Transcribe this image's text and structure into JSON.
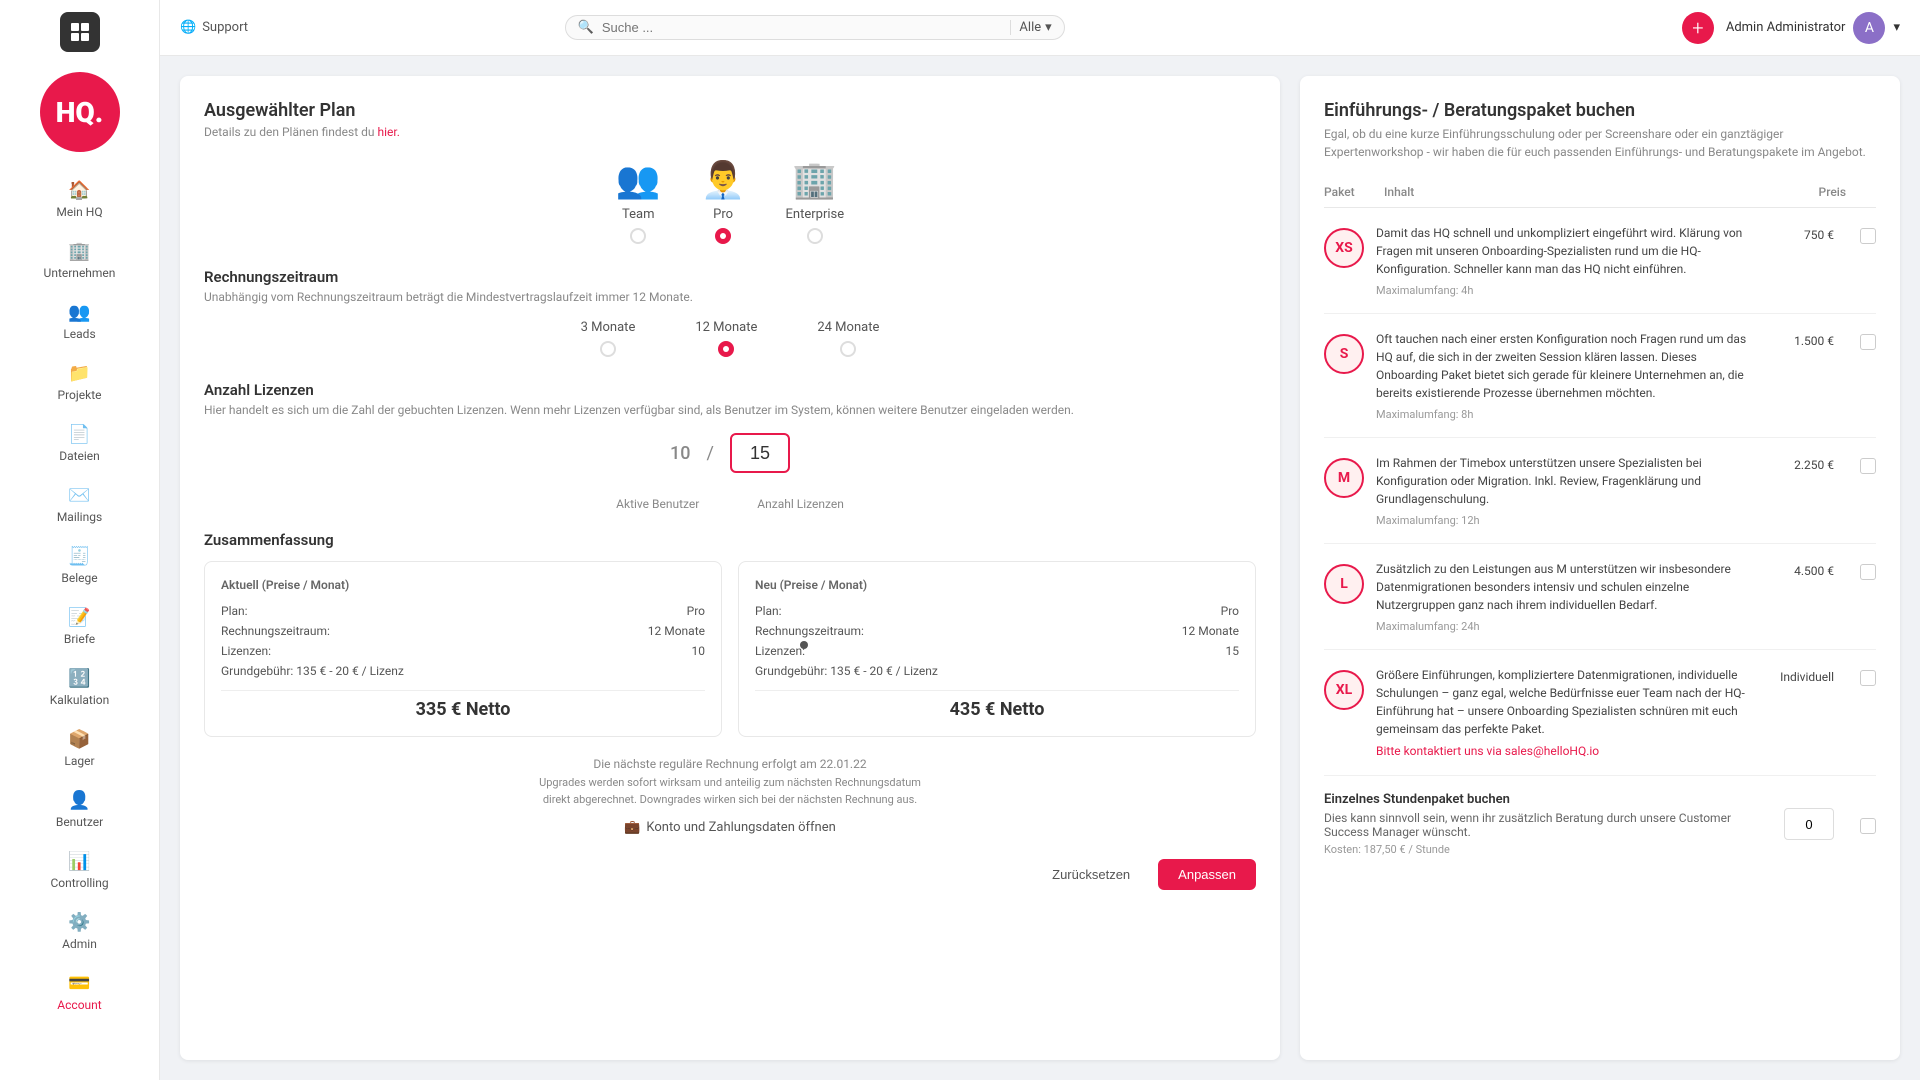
{
  "app": {
    "logo_text": "HQ.",
    "logo_small_text": "HQ"
  },
  "topbar": {
    "support_label": "Support",
    "search_placeholder": "Suche ...",
    "filter_label": "Alle",
    "user_name": "Admin Administrator",
    "add_icon": "+"
  },
  "sidebar": {
    "items": [
      {
        "id": "mein-hq",
        "label": "Mein HQ",
        "icon": "🏠"
      },
      {
        "id": "unternehmen",
        "label": "Unternehmen",
        "icon": "🏢"
      },
      {
        "id": "leads",
        "label": "Leads",
        "icon": "👥"
      },
      {
        "id": "projekte",
        "label": "Projekte",
        "icon": "📁"
      },
      {
        "id": "dateien",
        "label": "Dateien",
        "icon": "📄"
      },
      {
        "id": "mailings",
        "label": "Mailings",
        "icon": "✉️"
      },
      {
        "id": "belege",
        "label": "Belege",
        "icon": "🧾"
      },
      {
        "id": "briefe",
        "label": "Briefe",
        "icon": "📝"
      },
      {
        "id": "kalkulation",
        "label": "Kalkulation",
        "icon": "🔢"
      },
      {
        "id": "lager",
        "label": "Lager",
        "icon": "📦"
      },
      {
        "id": "benutzer",
        "label": "Benutzer",
        "icon": "👤"
      },
      {
        "id": "controlling",
        "label": "Controlling",
        "icon": "📊"
      },
      {
        "id": "admin",
        "label": "Admin",
        "icon": "⚙️"
      },
      {
        "id": "account",
        "label": "Account",
        "icon": "💳"
      }
    ]
  },
  "left_panel": {
    "title": "Ausgewählter Plan",
    "subtitle_text": "Details zu den Plänen findest du ",
    "subtitle_link": "hier.",
    "plans": [
      {
        "id": "team",
        "label": "Team",
        "selected": false,
        "icon": "👥"
      },
      {
        "id": "pro",
        "label": "Pro",
        "selected": true,
        "icon": "👨‍💼"
      },
      {
        "id": "enterprise",
        "label": "Enterprise",
        "selected": false,
        "icon": "🏢"
      }
    ],
    "billing_section_title": "Rechnungszeitraum",
    "billing_section_note": "Unabhängig vom Rechnungszeitraum beträgt die Mindestvertragslaufzeit immer 12 Monate.",
    "billing_options": [
      {
        "id": "3m",
        "label": "3 Monate",
        "selected": false
      },
      {
        "id": "12m",
        "label": "12 Monate",
        "selected": true
      },
      {
        "id": "24m",
        "label": "24 Monate",
        "selected": false
      }
    ],
    "licenses_title": "Anzahl Lizenzen",
    "licenses_note": "Hier handelt es sich um die Zahl der gebuchten Lizenzen. Wenn mehr Lizenzen verfügbar sind, als Benutzer im System, können weitere Benutzer eingeladen werden.",
    "active_users": "10",
    "license_count": "15",
    "active_label": "Aktive Benutzer",
    "license_label": "Anzahl Lizenzen",
    "summary_title": "Zusammenfassung",
    "current_box": {
      "title": "Aktuell (Preise / Monat)",
      "plan_label": "Plan:",
      "plan_value": "Pro",
      "billing_label": "Rechnungszeitraum:",
      "billing_value": "12 Monate",
      "licenses_label": "Lizenzen:",
      "licenses_value": "10",
      "grundgebuehr": "Grundgebühr: 135 € - 20 € / Lizenz",
      "total": "335 € Netto"
    },
    "new_box": {
      "title": "Neu (Preise / Monat)",
      "plan_label": "Plan:",
      "plan_value": "Pro",
      "billing_label": "Rechnungszeitraum:",
      "billing_value": "12 Monate",
      "licenses_label": "Lizenzen:",
      "licenses_value": "15",
      "grundgebuehr": "Grundgebühr: 135 € - 20 € / Lizenz",
      "total": "435 € Netto"
    },
    "next_invoice_note": "Die nächste reguläre Rechnung erfolgt am 22.01.22",
    "upgrade_note": "Upgrades werden sofort wirksam und anteilig zum nächsten Rechnungsdatum direkt abgerechnet. Downgrades wirken sich bei der nächsten Rechnung aus.",
    "konto_link": "Konto und Zahlungsdaten öffnen",
    "btn_reset": "Zurücksetzen",
    "btn_apply": "Anpassen"
  },
  "right_panel": {
    "title": "Einführungs- / Beratungspaket buchen",
    "subtitle": "Egal, ob du eine kurze Einführungsschulung oder per Screenshare oder ein ganztägiger Expertenworkshop - wir haben die für euch passenden Einführungs- und Beratungspakete im Angebot.",
    "header": {
      "paket": "Paket",
      "inhalt": "Inhalt",
      "preis": "Preis"
    },
    "packages": [
      {
        "id": "xs",
        "badge": "XS",
        "desc": "Damit das HQ schnell und unkompliziert eingeführt wird. Klärung von Fragen mit unseren Onboarding-Spezialisten rund um die HQ-Konfiguration. Schneller kann man das HQ nicht einführen.",
        "maxumfang": "Maximalumfang: 4h",
        "price": "750 €",
        "checked": false
      },
      {
        "id": "s",
        "badge": "S",
        "desc": "Oft tauchen nach einer ersten Konfiguration noch Fragen rund um das HQ auf, die sich in der zweiten Session klären lassen. Dieses Onboarding Paket bietet sich gerade für kleinere Unternehmen an, die bereits existierende Prozesse übernehmen möchten.",
        "maxumfang": "Maximalumfang: 8h",
        "price": "1.500 €",
        "checked": false
      },
      {
        "id": "m",
        "badge": "M",
        "desc": "Im Rahmen der Timebox unterstützen unsere Spezialisten bei Konfiguration oder Migration. Inkl. Review, Fragenklärung und Grundlagenschulung.",
        "maxumfang": "Maximalumfang: 12h",
        "price": "2.250 €",
        "checked": false
      },
      {
        "id": "l",
        "badge": "L",
        "desc": "Zusätzlich zu den Leistungen aus M unterstützen wir insbesondere Datenmigrationen besonders intensiv und schulen einzelne Nutzergruppen ganz nach ihrem individuellen Bedarf.",
        "maxumfang": "Maximalumfang: 24h",
        "price": "4.500 €",
        "checked": false
      },
      {
        "id": "xl",
        "badge": "XL",
        "desc": "Größere Einführungen, kompliziertere Datenmigrationen, individuelle Schulungen – ganz egal, welche Bedürfnisse euer Team nach der HQ-Einführung hat – unsere Onboarding Spezialisten schnüren mit euch gemeinsam das perfekte Paket.",
        "price": "Individuell",
        "link_text": "Bitte kontaktiert uns via sales@helloHQ.io",
        "checked": false
      }
    ],
    "stunden": {
      "title": "Einzelnes Stundenpaket buchen",
      "desc": "Dies kann sinnvoll sein, wenn ihr zusätzlich Beratung durch unsere Customer Success Manager wünscht.",
      "kosten": "Kosten: 187,50 € / Stunde",
      "value": "0"
    }
  }
}
